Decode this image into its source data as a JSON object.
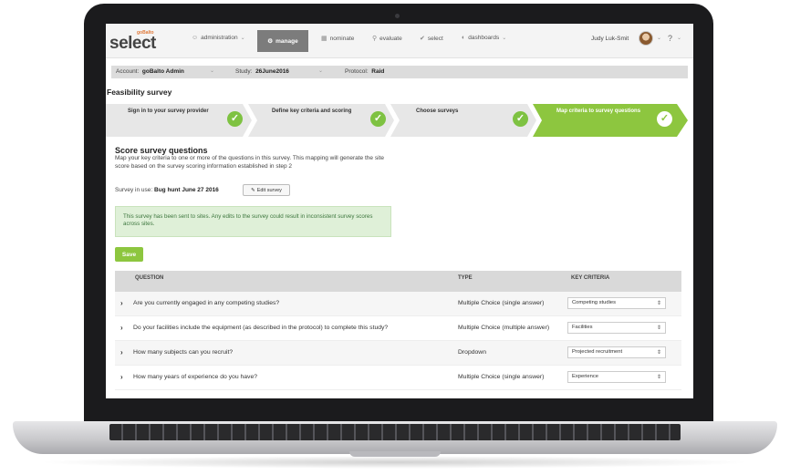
{
  "nav": {
    "logo_small": "goBalto",
    "logo_big": "select",
    "items": [
      {
        "label": "administration",
        "icon": "user-icon"
      },
      {
        "label": "manage",
        "icon": "gear-icon"
      },
      {
        "label": "nominate",
        "icon": "building-icon"
      },
      {
        "label": "evaluate",
        "icon": "search-icon"
      },
      {
        "label": "select",
        "icon": "check-circle-icon"
      },
      {
        "label": "dashboards",
        "icon": "dashboard-icon"
      }
    ],
    "user_name": "Judy Luk-Smit",
    "help": "?"
  },
  "context": {
    "account_label": "Account:",
    "account_value": "goBalto Admin",
    "study_label": "Study:",
    "study_value": "26June2016",
    "protocol_label": "Protocol:",
    "protocol_value": "Raid"
  },
  "page_title": "Feasibility survey",
  "steps": [
    {
      "label": "Sign in to your survey provider",
      "done": true
    },
    {
      "label": "Define key criteria and scoring",
      "done": true
    },
    {
      "label": "Choose surveys",
      "done": true
    },
    {
      "label": "Map criteria to survey questions",
      "done": true,
      "active": true
    }
  ],
  "section": {
    "title": "Score survey questions",
    "description": "Map your key criteria to one or more of the questions in this survey. This mapping will generate the site score based on the survey scoring information established in step 2",
    "survey_in_use_label": "Survey in use:",
    "survey_in_use_value": "Bug hunt June 27 2016",
    "edit_button": "Edit survey",
    "alert": "This survey has been sent to sites. Any edits to the survey could result in inconsistent survey scores across sites.",
    "save_button": "Save"
  },
  "table": {
    "headers": [
      "QUESTION",
      "TYPE",
      "KEY CRITERIA"
    ],
    "rows": [
      {
        "question": "Are you currently engaged in any competing studies?",
        "type": "Multiple Choice (single answer)",
        "criteria": "Competing studies"
      },
      {
        "question": "Do your facilities include the equipment (as described in the protocol) to complete this study?",
        "type": "Multiple Choice (multiple answer)",
        "criteria": "Facilities"
      },
      {
        "question": "How many subjects can you recruit?",
        "type": "Dropdown",
        "criteria": "Projected recruitment"
      },
      {
        "question": "How many years of experience do you have?",
        "type": "Multiple Choice (single answer)",
        "criteria": "Experience"
      }
    ]
  },
  "colors": {
    "accent_green": "#8dc63f",
    "check_green": "#7ec242",
    "nav_active": "#7c7c7c",
    "alert_bg": "#dff0d8",
    "alert_text": "#3c763d"
  }
}
